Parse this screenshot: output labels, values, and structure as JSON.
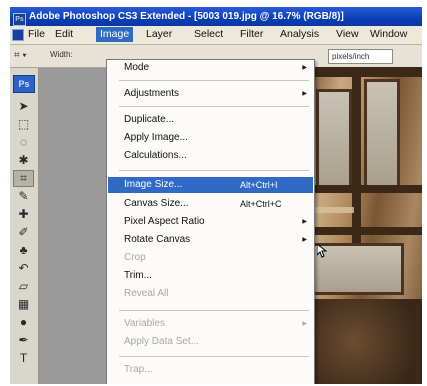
{
  "window": {
    "title": "Adobe Photoshop CS3 Extended - [5003 019.jpg @ 16.7% (RGB/8)]"
  },
  "menubar": {
    "items": [
      "File",
      "Edit",
      "Image",
      "Layer",
      "Select",
      "Filter",
      "Analysis",
      "View",
      "Window"
    ],
    "active": "Image"
  },
  "options_bar": {
    "tool_preset_icon": "crop-tool-icon",
    "label": "Width:",
    "right_field": "pixels/inch"
  },
  "toolbox": {
    "logo": "Ps",
    "tools": [
      "move-tool-icon",
      "marquee-tool-icon",
      "lasso-tool-icon",
      "magic-wand-tool-icon",
      "crop-tool-icon",
      "slice-tool-icon",
      "healing-brush-icon",
      "brush-tool-icon",
      "clone-stamp-icon",
      "history-brush-icon",
      "eraser-icon",
      "gradient-tool-icon",
      "dodge-tool-icon",
      "pen-tool-icon",
      "text-tool-icon"
    ]
  },
  "image_menu": {
    "items": [
      {
        "label": "Mode",
        "submenu": true
      },
      {
        "label": "Adjustments",
        "submenu": true
      },
      {
        "label": "Duplicate..."
      },
      {
        "label": "Apply Image..."
      },
      {
        "label": "Calculations..."
      },
      {
        "label": "Image Size...",
        "shortcut": "Alt+Ctrl+I",
        "highlighted": true
      },
      {
        "label": "Canvas Size...",
        "shortcut": "Alt+Ctrl+C"
      },
      {
        "label": "Pixel Aspect Ratio",
        "submenu": true
      },
      {
        "label": "Rotate Canvas",
        "submenu": true
      },
      {
        "label": "Crop",
        "disabled": true
      },
      {
        "label": "Trim..."
      },
      {
        "label": "Reveal All",
        "disabled": true
      },
      {
        "label": "Variables",
        "submenu": true,
        "disabled": true
      },
      {
        "label": "Apply Data Set...",
        "disabled": true
      },
      {
        "label": "Trap...",
        "disabled": true
      }
    ]
  },
  "colors": {
    "menu_highlight": "#316ac5",
    "titlebar": "#0b3fb8",
    "disabled_text": "#a9a9a9"
  }
}
